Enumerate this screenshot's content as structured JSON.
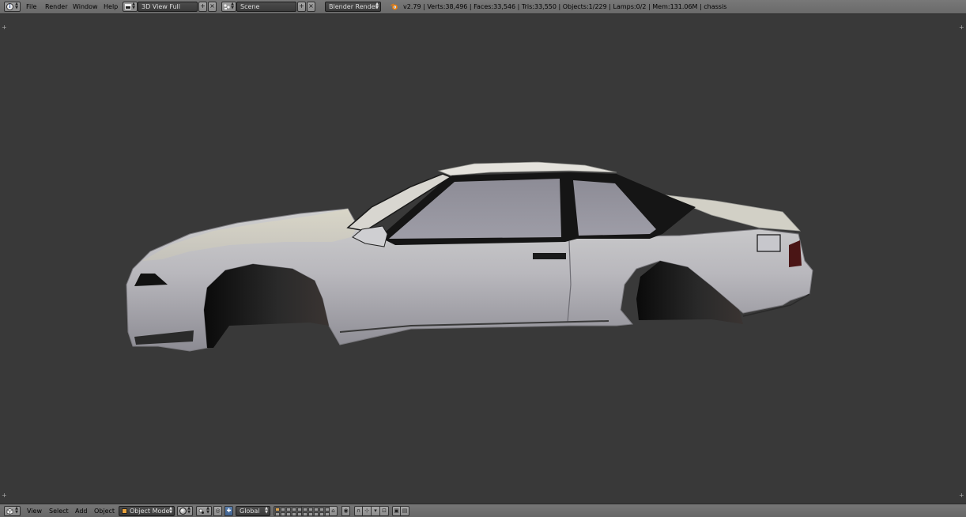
{
  "top_header": {
    "editor_icon": "info-icon",
    "menus": [
      "File",
      "Render",
      "Window",
      "Help"
    ],
    "screen_layout": {
      "icon": "layout-grid-icon",
      "value": "3D View Full",
      "add": "+",
      "remove": "×"
    },
    "scene": {
      "icon": "scene-icon",
      "value": "Scene",
      "add": "+",
      "remove": "×"
    },
    "render_engine": "Blender Render",
    "stats": "v2.79 | Verts:38,496 | Faces:33,546 | Tris:33,550 | Objects:1/229 | Lamps:0/2 | Mem:131.06M | chassis"
  },
  "viewport": {
    "object": "car-chassis-model",
    "corner_marker": "+"
  },
  "bottom_header": {
    "editor_icon": "3d-view-icon",
    "menus": [
      "View",
      "Select",
      "Add",
      "Object"
    ],
    "mode": "Object Mode",
    "transform_orientation": "Global",
    "colors": {
      "header": "#6f6f6f",
      "viewport": "#393939",
      "active_button": "#4a6e9c",
      "active_layer": "#d9a352"
    }
  }
}
